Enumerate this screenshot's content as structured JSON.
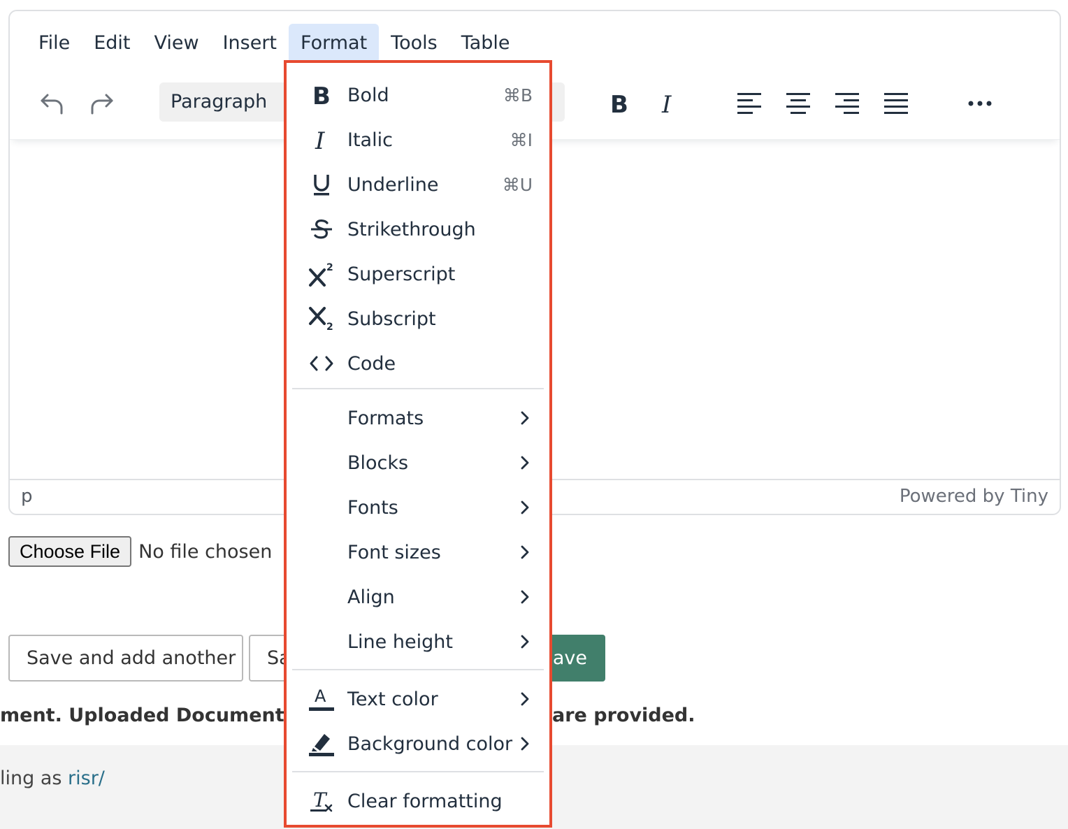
{
  "menubar": {
    "items": [
      "File",
      "Edit",
      "View",
      "Insert",
      "Format",
      "Tools",
      "Table"
    ],
    "active": "Format"
  },
  "toolbar": {
    "block_format": "Paragraph",
    "icons": [
      "undo-icon",
      "redo-icon",
      "bold-icon",
      "italic-icon",
      "align-left-icon",
      "align-center-icon",
      "align-right-icon",
      "align-justify-icon",
      "more-icon"
    ]
  },
  "statusbar": {
    "path": "p",
    "branding": "Powered by Tiny"
  },
  "file_input": {
    "button_label": "Choose File",
    "status": "No file chosen"
  },
  "actions": {
    "save_add_another": "Save and add another",
    "save_continue_partial": "Sa",
    "save_partial": "ave"
  },
  "notice": {
    "left": "ment. Uploaded Document is",
    "right": "are provided."
  },
  "footer": {
    "prefix": "ling as ",
    "user": "risr/"
  },
  "format_menu": {
    "basic": [
      {
        "label": "Bold",
        "shortcut": "⌘B",
        "icon": "bold-icon"
      },
      {
        "label": "Italic",
        "shortcut": "⌘I",
        "icon": "italic-icon"
      },
      {
        "label": "Underline",
        "shortcut": "⌘U",
        "icon": "underline-icon"
      },
      {
        "label": "Strikethrough",
        "shortcut": "",
        "icon": "strikethrough-icon"
      },
      {
        "label": "Superscript",
        "shortcut": "",
        "icon": "superscript-icon"
      },
      {
        "label": "Subscript",
        "shortcut": "",
        "icon": "subscript-icon"
      },
      {
        "label": "Code",
        "shortcut": "",
        "icon": "code-icon"
      }
    ],
    "submenus": [
      "Formats",
      "Blocks",
      "Fonts",
      "Font sizes",
      "Align",
      "Line height"
    ],
    "colors": [
      {
        "label": "Text color",
        "icon": "text-color-icon"
      },
      {
        "label": "Background color",
        "icon": "highlight-icon"
      }
    ],
    "clear": {
      "label": "Clear formatting",
      "icon": "clear-formatting-icon"
    }
  },
  "colors": {
    "accent_border": "#e74a30",
    "active_menu_bg": "#dbe8fb",
    "save_button": "#417f6b",
    "link": "#2a6f8a"
  }
}
